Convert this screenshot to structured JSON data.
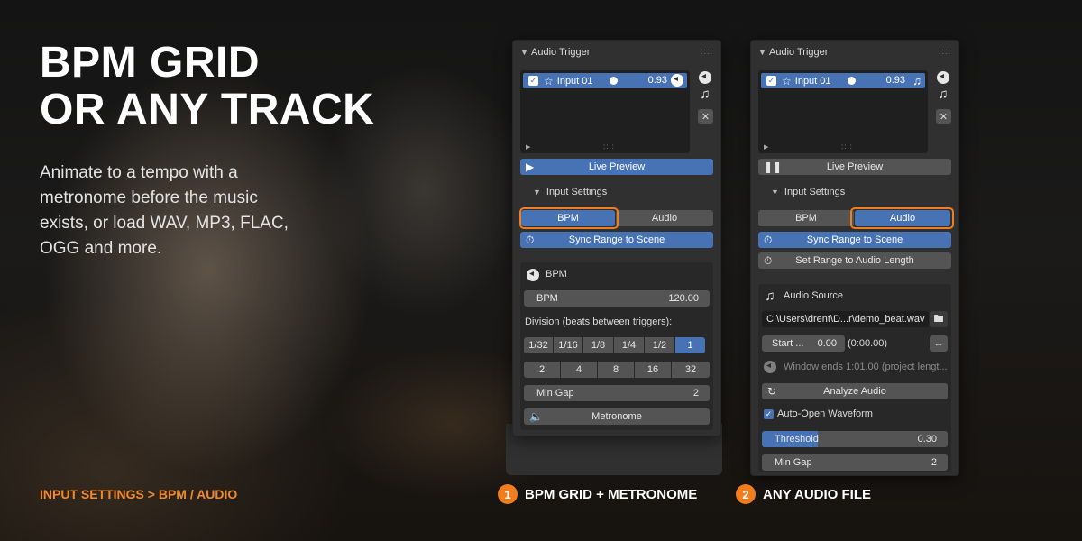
{
  "hero": {
    "title_line1": "BPM GRID",
    "title_line2": "OR ANY TRACK",
    "body": "Animate to a tempo with a metronome before the music exists, or load WAV, MP3, FLAC, OGG and more.",
    "breadcrumb": "INPUT SETTINGS  >  BPM / AUDIO"
  },
  "captions": [
    {
      "number": "1",
      "label": "BPM GRID + METRONOME"
    },
    {
      "number": "2",
      "label": "ANY AUDIO FILE"
    }
  ],
  "colors": {
    "accent": "#f07d1e",
    "selected": "#4772b3",
    "panel": "#303030",
    "button": "#545454"
  },
  "panel_bpm": {
    "title": "Audio Trigger",
    "list_item": {
      "label": "Input 01",
      "value": "0.93",
      "icon": "metronome-icon"
    },
    "live_preview": "Live Preview",
    "input_settings": "Input Settings",
    "mode_bpm": "BPM",
    "mode_audio": "Audio",
    "selected_mode": "BPM",
    "sync_range": "Sync Range to Scene",
    "sub_title": "BPM",
    "bpm_label": "BPM",
    "bpm_value": "120.00",
    "division_label": "Division (beats between triggers):",
    "divisions_row1": [
      "1/32",
      "1/16",
      "1/8",
      "1/4",
      "1/2",
      "1"
    ],
    "divisions_row2": [
      "2",
      "4",
      "8",
      "16",
      "32"
    ],
    "selected_division": "1",
    "min_gap_label": "Min Gap",
    "min_gap_value": "2",
    "metronome": "Metronome"
  },
  "panel_audio": {
    "title": "Audio Trigger",
    "list_item": {
      "label": "Input 01",
      "value": "0.93",
      "icon": "music-note-icon"
    },
    "live_preview": "Live Preview",
    "input_settings": "Input Settings",
    "mode_bpm": "BPM",
    "mode_audio": "Audio",
    "selected_mode": "Audio",
    "sync_range": "Sync Range to Scene",
    "set_range": "Set Range to Audio Length",
    "sub_title": "Audio Source",
    "file_path": "C:\\Users\\drent\\D...r\\demo_beat.wav",
    "start_label": "Start ...",
    "start_value": "0.00",
    "start_time": "(0:00.00)",
    "window_info": "Window ends 1:01.00 (project lengt...",
    "analyze": "Analyze Audio",
    "auto_open": "Auto-Open Waveform",
    "auto_open_checked": true,
    "threshold_label": "Threshold",
    "threshold_value": "0.30",
    "threshold_fraction": 0.3,
    "min_gap_label": "Min Gap",
    "min_gap_value": "2"
  }
}
